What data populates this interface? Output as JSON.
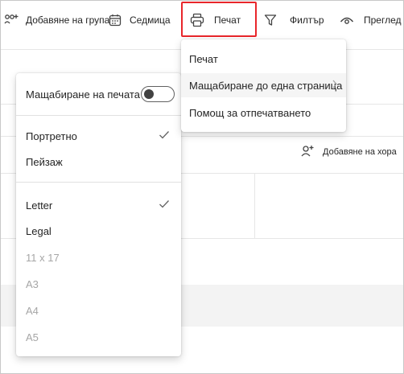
{
  "toolbar": {
    "add_group_label": "Добавяне на група",
    "week_label": "Седмица",
    "print_label": "Печат",
    "filter_label": "Филтър",
    "view_label": "Преглед"
  },
  "add_people_label": "Добавяне на хора",
  "print_menu": {
    "items": [
      {
        "label": "Печат"
      },
      {
        "label": "Мащабиране до една страница"
      },
      {
        "label": "Помощ за отпечатването"
      }
    ]
  },
  "scale_menu": {
    "toggle_label": "Мащабиране на печата",
    "toggle_on": false,
    "orientation": [
      {
        "label": "Портретно",
        "checked": true
      },
      {
        "label": "Пейзаж",
        "checked": false
      }
    ],
    "paper_sizes": [
      {
        "label": "Letter",
        "checked": true,
        "enabled": true
      },
      {
        "label": "Legal",
        "checked": false,
        "enabled": true
      },
      {
        "label": "11 x 17",
        "checked": false,
        "enabled": false
      },
      {
        "label": "A3",
        "checked": false,
        "enabled": false
      },
      {
        "label": "A4",
        "checked": false,
        "enabled": false
      },
      {
        "label": "A5",
        "checked": false,
        "enabled": false
      }
    ]
  },
  "colors": {
    "highlight": "#e8262b",
    "disabled_text": "#a6a6a6",
    "text": "#242424"
  }
}
